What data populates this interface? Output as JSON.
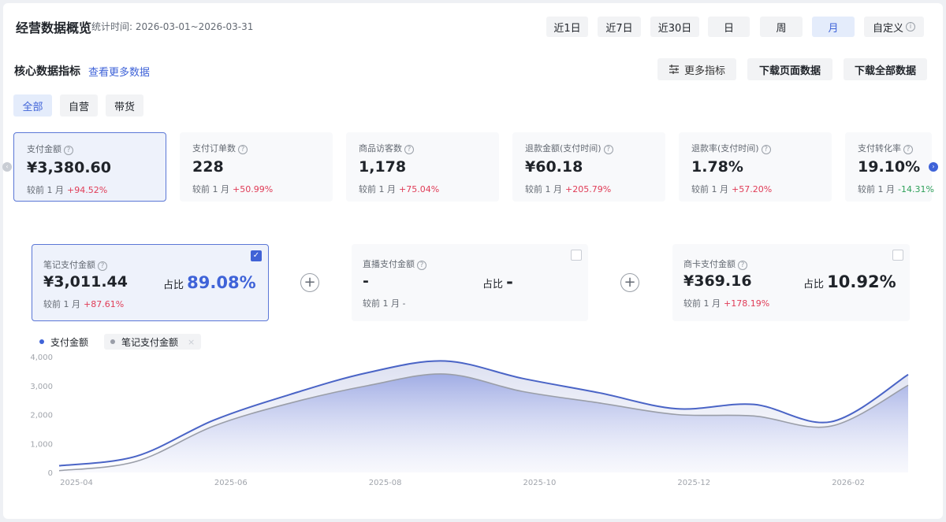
{
  "header": {
    "title": "经营数据概览",
    "stat_time": "统计时间: 2026-03-01~2026-03-31",
    "ranges": [
      "近1日",
      "近7日",
      "近30日",
      "日",
      "周",
      "月",
      "自定义"
    ],
    "active_range": "月"
  },
  "core": {
    "title": "核心数据指标",
    "more_link": "查看更多数据",
    "more_metrics": "更多指标",
    "download_page": "下载页面数据",
    "download_all": "下载全部数据"
  },
  "filters": {
    "items": [
      "全部",
      "自营",
      "带货"
    ],
    "active": "全部"
  },
  "metrics": [
    {
      "label": "支付金额",
      "value": "¥3,380.60",
      "cmp_label": "较前 1 月",
      "change": "+94.52%",
      "dir": "up"
    },
    {
      "label": "支付订单数",
      "value": "228",
      "cmp_label": "较前 1 月",
      "change": "+50.99%",
      "dir": "up"
    },
    {
      "label": "商品访客数",
      "value": "1,178",
      "cmp_label": "较前 1 月",
      "change": "+75.04%",
      "dir": "up"
    },
    {
      "label": "退款金额(支付时间)",
      "value": "¥60.18",
      "cmp_label": "较前 1 月",
      "change": "+205.79%",
      "dir": "up"
    },
    {
      "label": "退款率(支付时间)",
      "value": "1.78%",
      "cmp_label": "较前 1 月",
      "change": "+57.20%",
      "dir": "up"
    },
    {
      "label": "支付转化率",
      "value": "19.10%",
      "cmp_label": "较前 1 月",
      "change": "-14.31%",
      "dir": "down"
    }
  ],
  "breakdown": [
    {
      "label": "笔记支付金额",
      "value": "¥3,011.44",
      "share_label": "占比",
      "share": "89.08%",
      "cmp_label": "较前 1 月",
      "change": "+87.61%",
      "checked": true
    },
    {
      "label": "直播支付金额",
      "value": "-",
      "share_label": "占比",
      "share": "-",
      "cmp_label": "较前 1 月",
      "change": "-",
      "checked": false
    },
    {
      "label": "商卡支付金额",
      "value": "¥369.16",
      "share_label": "占比",
      "share": "10.92%",
      "cmp_label": "较前 1 月",
      "change": "+178.19%",
      "checked": false
    }
  ],
  "colors": {
    "accent": "#3f63d8",
    "series_primary": "#4a64c6",
    "series_secondary": "#9a9ea8",
    "up": "#e03c57",
    "down": "#2fa05a"
  },
  "chart_data": {
    "type": "area",
    "x": [
      "2025-04",
      "2025-05",
      "2025-06",
      "2025-07",
      "2025-08",
      "2025-09",
      "2025-10",
      "2025-11",
      "2025-12",
      "2026-01",
      "2026-02",
      "2026-03"
    ],
    "x_ticks": [
      "2025-04",
      "2025-06",
      "2025-08",
      "2025-10",
      "2025-12",
      "2026-02"
    ],
    "y_ticks": [
      "0",
      "1,000",
      "2,000",
      "3,000",
      "4,000"
    ],
    "ylim": [
      0,
      4000
    ],
    "series": [
      {
        "name": "支付金额",
        "values": [
          230,
          560,
          1800,
          2700,
          3450,
          3850,
          3250,
          2750,
          2200,
          2350,
          1750,
          3380
        ]
      },
      {
        "name": "笔记支付金额",
        "values": [
          60,
          380,
          1600,
          2400,
          3000,
          3400,
          2800,
          2400,
          2000,
          1950,
          1600,
          3011
        ]
      }
    ],
    "legend_position": "top-left",
    "grid": false
  }
}
